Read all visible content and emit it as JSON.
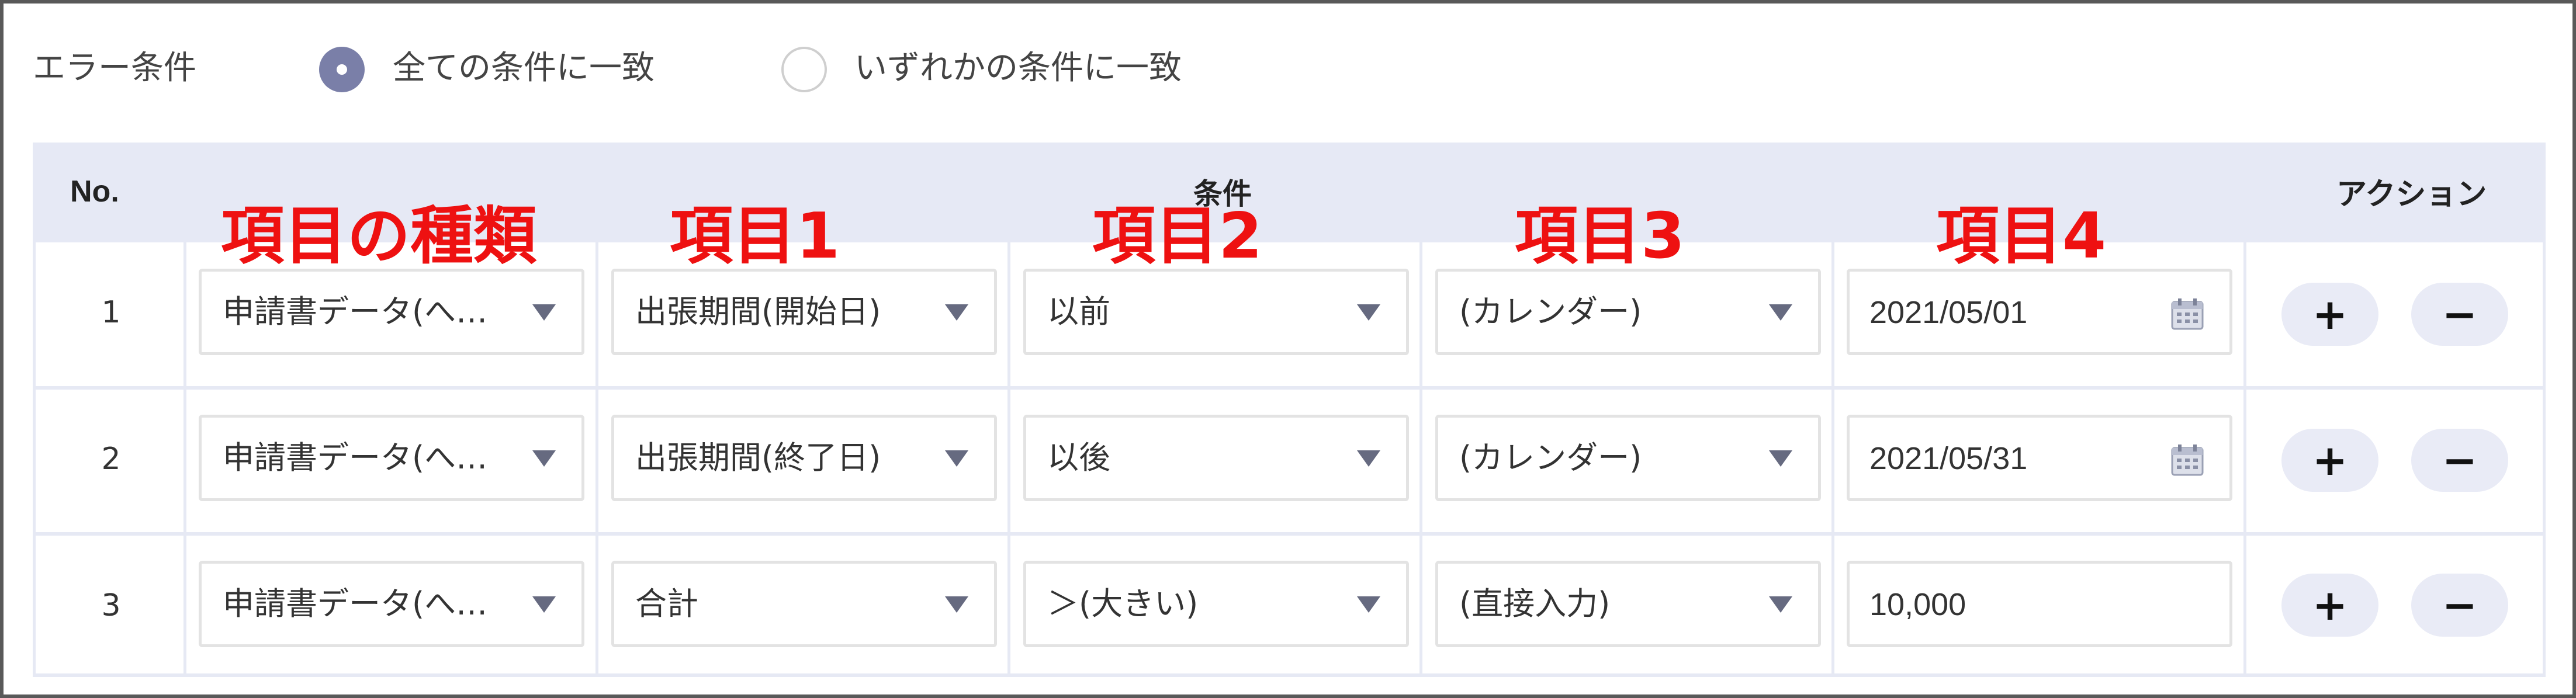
{
  "error_condition": {
    "label": "エラー条件",
    "options": [
      {
        "label": "全ての条件に一致",
        "selected": true
      },
      {
        "label": "いずれかの条件に一致",
        "selected": false
      }
    ]
  },
  "table": {
    "headers": {
      "no": "No.",
      "condition": "条件",
      "action": "アクション"
    },
    "annotations": [
      "項目の種類",
      "項目1",
      "項目2",
      "項目3",
      "項目4"
    ],
    "rows": [
      {
        "no": "1",
        "item_type": "申請書データ(へ…",
        "item1": "出張期間(開始日)",
        "item2": "以前",
        "item3": "(カレンダー)",
        "item4": "2021/05/01",
        "item4_has_calendar": true
      },
      {
        "no": "2",
        "item_type": "申請書データ(へ…",
        "item1": "出張期間(終了日)",
        "item2": "以後",
        "item3": "(カレンダー)",
        "item4": "2021/05/31",
        "item4_has_calendar": true
      },
      {
        "no": "3",
        "item_type": "申請書データ(へ…",
        "item1": "合計",
        "item2": "＞(大きい)",
        "item3": "(直接入力)",
        "item4": "10,000",
        "item4_has_calendar": false
      }
    ],
    "action_buttons": {
      "add": "+",
      "remove": "−"
    }
  },
  "colors": {
    "frame_border": "#595959",
    "header_bg": "#e6e9f5",
    "radio_selected": "#7a7fa8",
    "annotation": "#ee1111",
    "pill_bg": "#e9ebf6"
  }
}
